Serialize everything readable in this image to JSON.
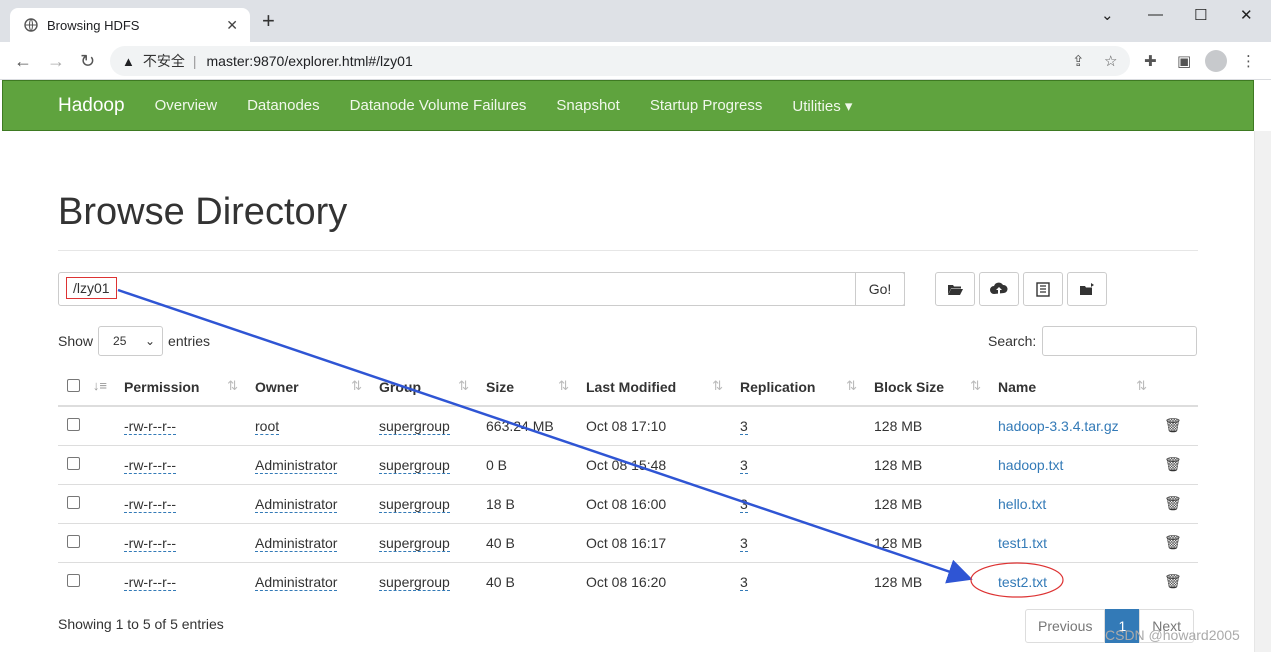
{
  "browser": {
    "tab_title": "Browsing HDFS",
    "tab_close": "✕",
    "new_tab": "+",
    "insecure_label": "不安全",
    "separator": "|",
    "url": "master:9870/explorer.html#/lzy01",
    "window_controls": [
      "⌄",
      "—",
      "☐",
      "✕"
    ]
  },
  "navbar": {
    "brand": "Hadoop",
    "links": [
      "Overview",
      "Datanodes",
      "Datanode Volume Failures",
      "Snapshot",
      "Startup Progress",
      "Utilities ▾"
    ],
    "bg_color": "#5fa33e"
  },
  "page": {
    "title": "Browse Directory",
    "directory_value": "/lzy01",
    "go_label": "Go!",
    "show_label": "Show",
    "entries_label": "entries",
    "page_size": "25",
    "search_label": "Search:",
    "footer_text": "Showing 1 to 5 of 5 entries",
    "pager": {
      "previous": "Previous",
      "current": "1",
      "next": "Next"
    },
    "watermark": "CSDN @howard2005"
  },
  "table": {
    "columns": [
      "Permission",
      "Owner",
      "Group",
      "Size",
      "Last Modified",
      "Replication",
      "Block Size",
      "Name"
    ],
    "rows": [
      {
        "permission": "-rw-r--r--",
        "owner": "root",
        "group": "supergroup",
        "size": "663.24 MB",
        "modified": "Oct 08 17:10",
        "replication": "3",
        "block": "128 MB",
        "name": "hadoop-3.3.4.tar.gz"
      },
      {
        "permission": "-rw-r--r--",
        "owner": "Administrator",
        "group": "supergroup",
        "size": "0 B",
        "modified": "Oct 08 15:48",
        "replication": "3",
        "block": "128 MB",
        "name": "hadoop.txt"
      },
      {
        "permission": "-rw-r--r--",
        "owner": "Administrator",
        "group": "supergroup",
        "size": "18 B",
        "modified": "Oct 08 16:00",
        "replication": "3",
        "block": "128 MB",
        "name": "hello.txt"
      },
      {
        "permission": "-rw-r--r--",
        "owner": "Administrator",
        "group": "supergroup",
        "size": "40 B",
        "modified": "Oct 08 16:17",
        "replication": "3",
        "block": "128 MB",
        "name": "test1.txt"
      },
      {
        "permission": "-rw-r--r--",
        "owner": "Administrator",
        "group": "supergroup",
        "size": "40 B",
        "modified": "Oct 08 16:20",
        "replication": "3",
        "block": "128 MB",
        "name": "test2.txt"
      }
    ]
  },
  "icons": {
    "trash": "🗑",
    "sort": "⇅",
    "sort_asc": "↓≡"
  }
}
